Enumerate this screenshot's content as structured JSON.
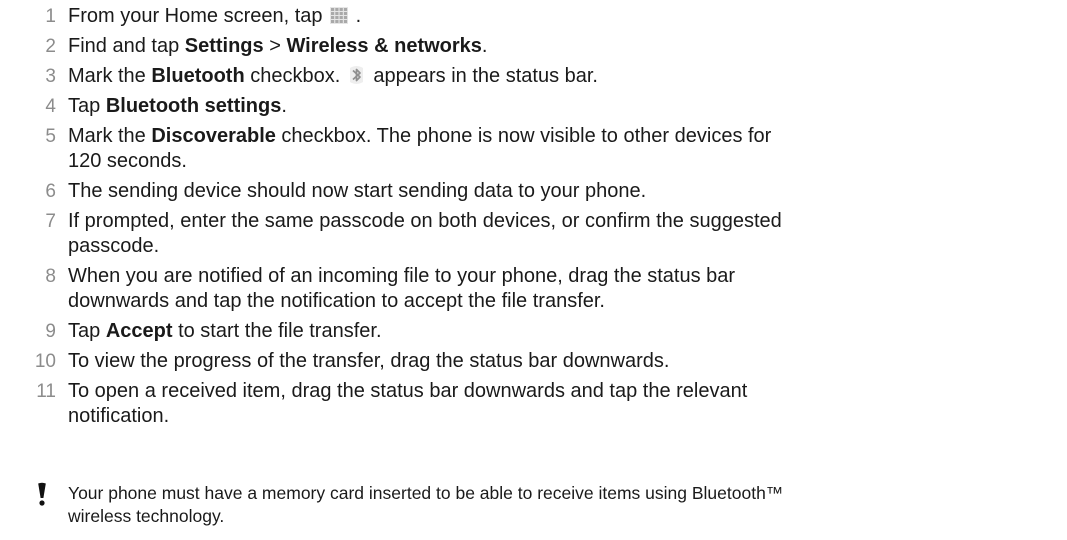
{
  "steps": [
    {
      "num": "1",
      "parts": [
        {
          "t": "From your Home screen, tap "
        },
        {
          "icon": "app-grid-icon"
        },
        {
          "t": " ."
        }
      ]
    },
    {
      "num": "2",
      "parts": [
        {
          "t": "Find and tap "
        },
        {
          "b": "Settings"
        },
        {
          "t": " > "
        },
        {
          "b": "Wireless & networks"
        },
        {
          "t": "."
        }
      ]
    },
    {
      "num": "3",
      "parts": [
        {
          "t": "Mark the "
        },
        {
          "b": "Bluetooth"
        },
        {
          "t": " checkbox. "
        },
        {
          "icon": "bluetooth-icon"
        },
        {
          "t": " appears in the status bar."
        }
      ]
    },
    {
      "num": "4",
      "parts": [
        {
          "t": "Tap "
        },
        {
          "b": "Bluetooth settings"
        },
        {
          "t": "."
        }
      ]
    },
    {
      "num": "5",
      "parts": [
        {
          "t": "Mark the "
        },
        {
          "b": "Discoverable"
        },
        {
          "t": " checkbox. The phone is now visible to other devices for"
        },
        {
          "br": true
        },
        {
          "t": "120 seconds."
        }
      ]
    },
    {
      "num": "6",
      "parts": [
        {
          "t": "The sending device should now start sending data to your phone."
        }
      ]
    },
    {
      "num": "7",
      "parts": [
        {
          "t": "If prompted, enter the same passcode on both devices, or confirm the suggested"
        },
        {
          "br": true
        },
        {
          "t": "passcode."
        }
      ]
    },
    {
      "num": "8",
      "parts": [
        {
          "t": "When you are notified of an incoming file to your phone, drag the status bar"
        },
        {
          "br": true
        },
        {
          "t": "downwards and tap the notification to accept the file transfer."
        }
      ]
    },
    {
      "num": "9",
      "parts": [
        {
          "t": "Tap "
        },
        {
          "b": "Accept"
        },
        {
          "t": " to start the file transfer."
        }
      ]
    },
    {
      "num": "10",
      "parts": [
        {
          "t": "To view the progress of the transfer, drag the status bar downwards."
        }
      ]
    },
    {
      "num": "11",
      "parts": [
        {
          "t": "To open a received item, drag the status bar downwards and tap the relevant"
        },
        {
          "br": true
        },
        {
          "t": "notification."
        }
      ]
    }
  ],
  "note": {
    "icon": "exclamation-icon",
    "text_line1": "Your phone must have a memory card inserted to be able to receive items using Bluetooth™",
    "text_line2": "wireless technology."
  }
}
